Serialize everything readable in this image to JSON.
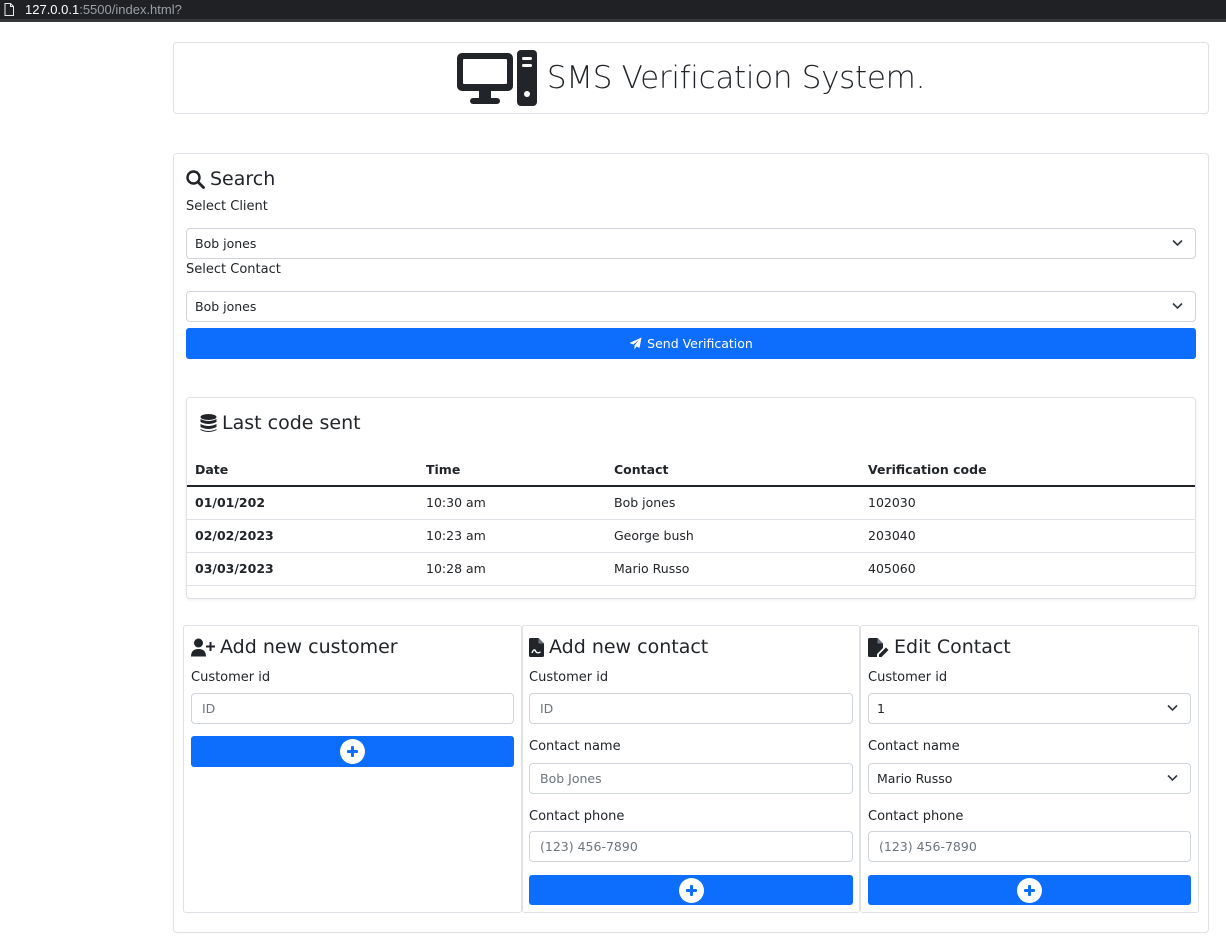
{
  "browser": {
    "url_host": "127.0.0.1",
    "url_rest": ":5500/index.html?"
  },
  "header": {
    "title": "SMS Verification System.",
    "icon": "desktop-computer-icon"
  },
  "search": {
    "title": "Search",
    "client_label": "Select Client",
    "client_value": "Bob jones",
    "contact_label": "Select Contact",
    "contact_value": "Bob jones",
    "send_label": "Send Verification"
  },
  "last_code": {
    "title": "Last code sent",
    "columns": [
      "Date",
      "Time",
      "Contact",
      "Verification code"
    ],
    "rows": [
      {
        "date": "01/01/202",
        "time": "10:30 am",
        "contact": "Bob jones",
        "code": "102030"
      },
      {
        "date": "02/02/2023",
        "time": "10:23 am",
        "contact": "George bush",
        "code": "203040"
      },
      {
        "date": "03/03/2023",
        "time": "10:28 am",
        "contact": "Mario Russo",
        "code": "405060"
      }
    ]
  },
  "add_customer": {
    "title": "Add new customer",
    "id_label": "Customer id",
    "id_placeholder": "ID"
  },
  "add_contact": {
    "title": "Add new contact",
    "id_label": "Customer id",
    "id_placeholder": "ID",
    "name_label": "Contact name",
    "name_placeholder": "Bob Jones",
    "phone_label": "Contact phone",
    "phone_placeholder": "(123) 456-7890"
  },
  "edit_contact": {
    "title": "Edit Contact",
    "id_label": "Customer id",
    "id_value": "1",
    "name_label": "Contact name",
    "name_value": "Mario Russo",
    "phone_label": "Contact phone",
    "phone_placeholder": "(123) 456-7890"
  },
  "colors": {
    "primary": "#0d6efd",
    "border": "#dee2e6",
    "text": "#212529"
  }
}
